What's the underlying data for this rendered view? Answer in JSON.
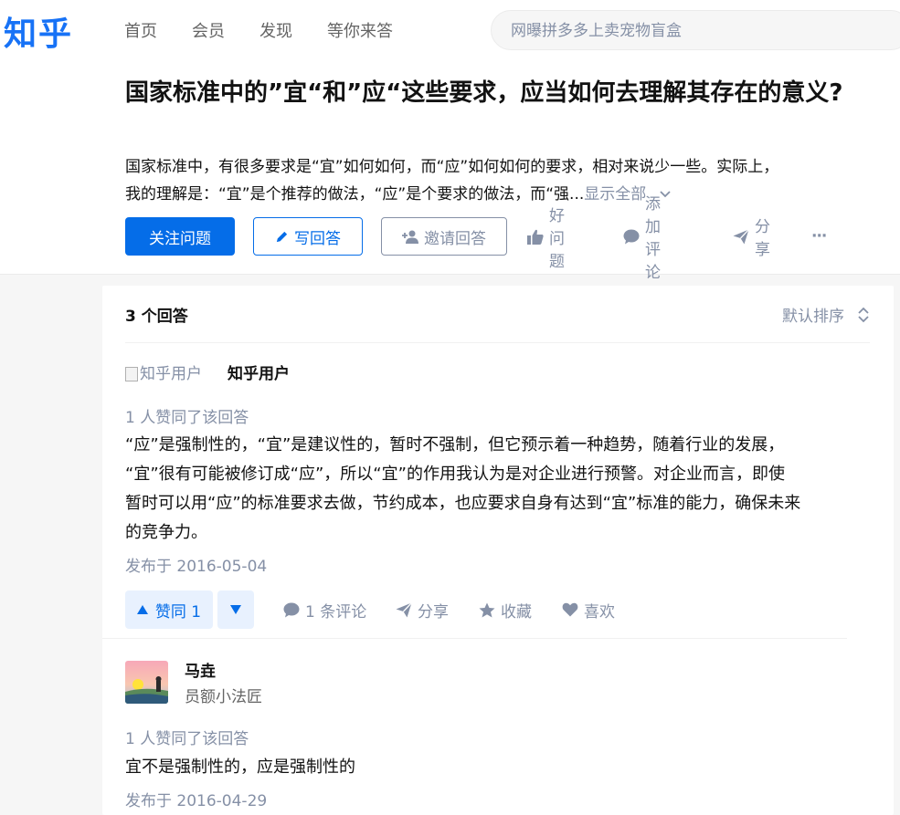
{
  "app": {
    "logo": "知乎",
    "brand_color": "#1772f6",
    "accent_color": "#056de8"
  },
  "nav": {
    "items": [
      "首页",
      "会员",
      "发现",
      "等你来答"
    ]
  },
  "search": {
    "placeholder": "网曝拼多多上卖宠物盲盒"
  },
  "question": {
    "title": "国家标准中的”宜“和”应“这些要求，应当如何去理解其存在的意义?",
    "excerpt_line1": "国家标准中，有很多要求是“宜”如何如何，而“应”如何如何的要求，相对来说少一些。实际上，",
    "excerpt_line2": "我的理解是：“宜”是个推荐的做法，“应”是个要求的做法，而“强...",
    "show_all": "显示全部",
    "follow_label": "关注问题",
    "write_label": "写回答",
    "invite_label": "邀请回答",
    "good_label": "好问题",
    "comment_label": "添加评论",
    "share_label": "分享",
    "more_label": "···"
  },
  "answer_list": {
    "count_label": "3 个回答",
    "sort_label": "默认排序"
  },
  "answers": [
    {
      "avatar_alt": "知乎用户",
      "author": "知乎用户",
      "votes_text": "1 人赞同了该回答",
      "content_lines": [
        "“应”是强制性的，“宜”是建议性的，暂时不强制，但它预示着一种趋势，随着行业的发展，",
        "“宜”很有可能被修订成“应”，所以“宜”的作用我认为是对企业进行预警。对企业而言，即使",
        "暂时可以用“应”的标准要求去做，节约成本，也应要求自身有达到“宜”标准的能力，确保未来",
        "的竞争力。"
      ],
      "date": "发布于 2016-05-04",
      "upvote_label": "赞同 1",
      "comments_label": "1 条评论",
      "share_label": "分享",
      "collect_label": "收藏",
      "like_label": "喜欢"
    },
    {
      "author": "马垚",
      "headline": "员额小法匠",
      "votes_text": "1 人赞同了该回答",
      "content": "宜不是强制性的，应是强制性的",
      "date": "发布于 2016-04-29"
    }
  ]
}
